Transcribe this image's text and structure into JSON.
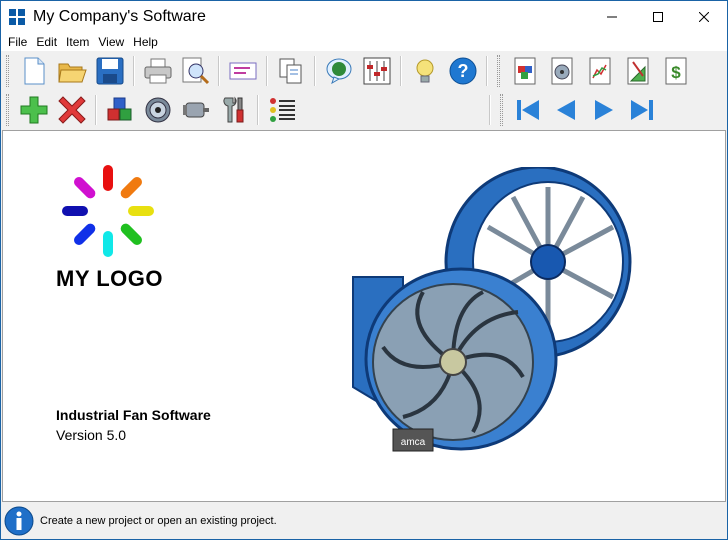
{
  "window": {
    "title": "My Company's Software"
  },
  "menu": {
    "items": [
      "File",
      "Edit",
      "Item",
      "View",
      "Help"
    ]
  },
  "splash": {
    "logo_text": "MY LOGO",
    "product_name": "Industrial Fan Software",
    "version": "Version 5.0"
  },
  "status": {
    "message": "Create a new project or open an existing project."
  },
  "colors": {
    "accent": "#0a5aa6",
    "border": "#1a63a6"
  }
}
